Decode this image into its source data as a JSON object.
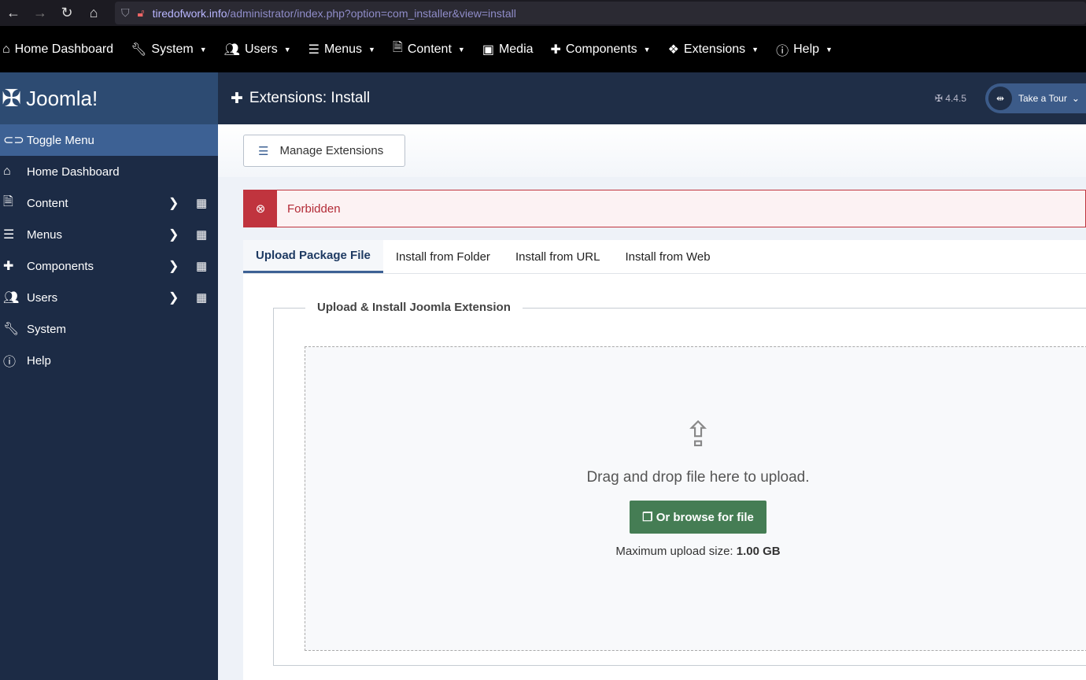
{
  "browser": {
    "url_domain": "tiredofwork.info",
    "url_path": "/administrator/index.php?option=com_installer&view=install"
  },
  "topnav": [
    {
      "label": "Home Dashboard",
      "icon": "home-icon"
    },
    {
      "label": "System",
      "icon": "wrench-icon"
    },
    {
      "label": "Users",
      "icon": "users-icon"
    },
    {
      "label": "Menus",
      "icon": "list-icon"
    },
    {
      "label": "Content",
      "icon": "file-icon"
    },
    {
      "label": "Media",
      "icon": "image-icon"
    },
    {
      "label": "Components",
      "icon": "puzzle-icon"
    },
    {
      "label": "Extensions",
      "icon": "cubes-icon"
    },
    {
      "label": "Help",
      "icon": "info-icon"
    }
  ],
  "logo": "Joomla!",
  "sidebar": [
    {
      "label": "Toggle Menu"
    },
    {
      "label": "Home Dashboard"
    },
    {
      "label": "Content"
    },
    {
      "label": "Menus"
    },
    {
      "label": "Components"
    },
    {
      "label": "Users"
    },
    {
      "label": "System"
    },
    {
      "label": "Help"
    }
  ],
  "header": {
    "title": "Extensions: Install",
    "version": "4.4.5",
    "tour": "Take a Tour"
  },
  "toolbar": {
    "manage": "Manage Extensions"
  },
  "alert": {
    "message": "Forbidden"
  },
  "tabs": [
    "Upload Package File",
    "Install from Folder",
    "Install from URL",
    "Install from Web"
  ],
  "upload": {
    "legend": "Upload & Install Joomla Extension",
    "drop_text": "Drag and drop file here to upload.",
    "browse": "Or browse for file",
    "max_label": "Maximum upload size:",
    "max_value": "1.00 GB"
  }
}
